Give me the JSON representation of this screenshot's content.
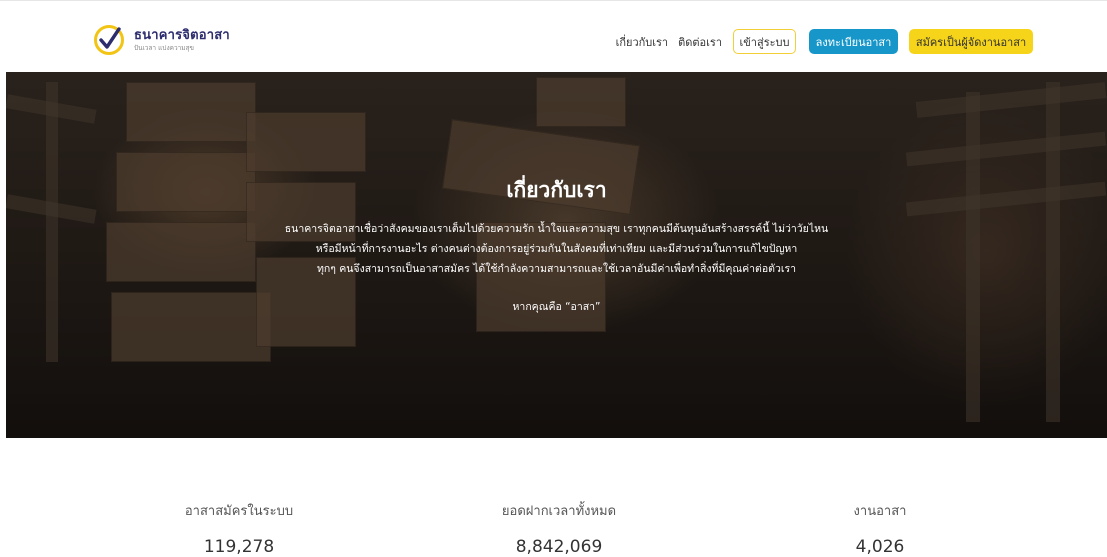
{
  "header": {
    "logo_name": "ธนาคารจิตอาสา",
    "logo_tagline": "ปันเวลา แบ่งความสุข",
    "nav_about": "เกี่ยวกับเรา",
    "nav_contact": "ติดต่อเรา",
    "login": "เข้าสู่ระบบ",
    "register": "ลงทะเบียนอาสา",
    "apply_organizer": "สมัครเป็นผู้จัดงานอาสา"
  },
  "hero": {
    "title": "เกี่ยวกับเรา",
    "line1": "ธนาคารจิตอาสาเชื่อว่าสังคมของเราเต็มไปด้วยความรัก น้ำใจและความสุข เราทุกคนมีต้นทุนอันสร้างสรรค์นี้ ไม่ว่าวัยไหน",
    "line2": "หรือมีหน้าที่การงานอะไร ต่างคนต่างต้องการอยู่ร่วมกันในสังคมที่เท่าเทียม และมีส่วนร่วมในการแก้ไขปัญหา",
    "line3": "ทุกๆ คนจึงสามารถเป็นอาสาสมัคร ได้ใช้กำลังความสามารถและใช้เวลาอันมีค่าเพื่อทำสิ่งที่มีคุณค่าต่อตัวเรา",
    "tagline": "หากคุณคือ “อาสา”"
  },
  "stats": [
    {
      "label": "อาสาสมัครในระบบ",
      "value": "119,278"
    },
    {
      "label": "ยอดฝากเวลาทั้งหมด",
      "value": "8,842,069"
    },
    {
      "label": "งานอาสา",
      "value": "4,026"
    }
  ],
  "colors": {
    "register_button": "#1797c9",
    "organizer_button": "#f5d41a",
    "login_border": "#f2cf35",
    "logo_text": "#2c2c6e"
  },
  "icons": {
    "logo": "checkmark-circle-icon"
  }
}
